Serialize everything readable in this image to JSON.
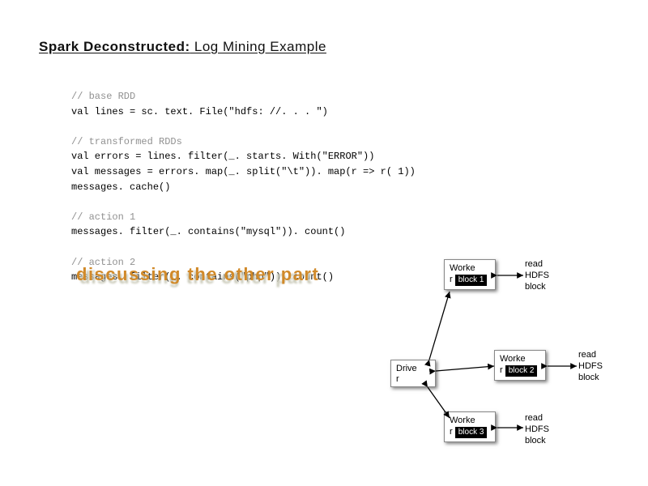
{
  "title": {
    "bold": "Spark Deconstructed:",
    "rest": " Log Mining Example"
  },
  "code": {
    "c1": "// base RDD",
    "l1": "val lines = sc. text. File(\"hdfs: //. . . \")",
    "c2": "// transformed RDDs",
    "l2": "val errors = lines. filter(_. starts. With(\"ERROR\"))",
    "l3": "val messages = errors. map(_. split(\"\\t\")). map(r => r( 1))",
    "l4": "messages. cache()",
    "c3": "// action 1",
    "l5": "messages. filter(_. contains(\"mysql\")). count()",
    "c4": "// action 2",
    "l6": "messages. filter(_. contains(\"php\")). count()"
  },
  "overlay": {
    "ghost": "discussing the other part",
    "text": "discussing the other part"
  },
  "diagram": {
    "driver": "Drive\nr",
    "worker1": {
      "label": "Worke\nr",
      "block": "block 1"
    },
    "worker2": {
      "label": "Worke\nr",
      "block": "block 2"
    },
    "worker3": {
      "label": "Worke\nr",
      "block": "block 3"
    },
    "read_label": "read\nHDFS\nblock"
  }
}
